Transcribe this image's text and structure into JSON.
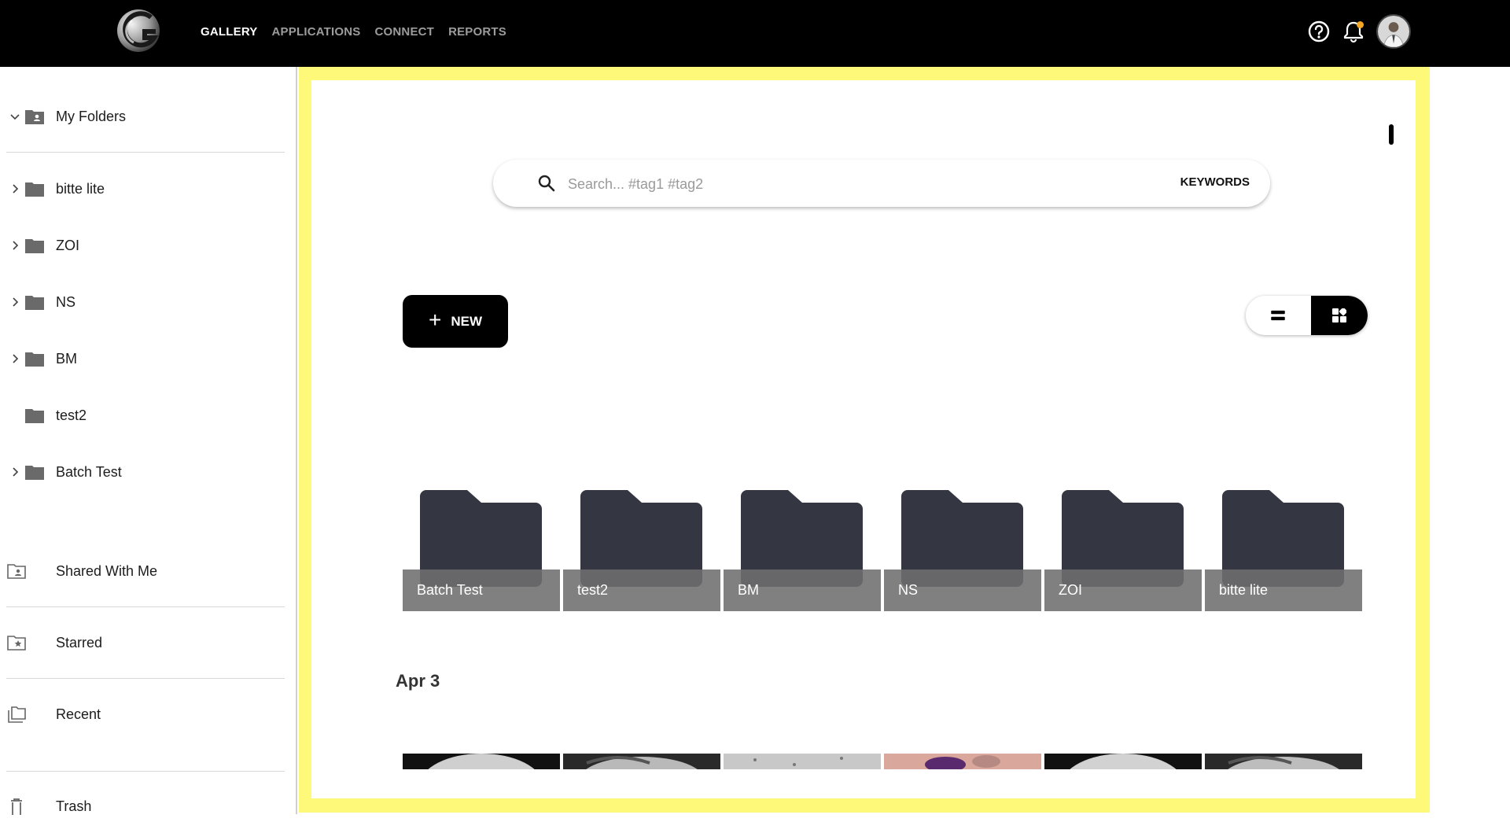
{
  "topbar": {
    "nav": [
      "GALLERY",
      "APPLICATIONS",
      "CONNECT",
      "REPORTS"
    ],
    "active_nav": "GALLERY",
    "notification_color": "#f5a623"
  },
  "sidebar": {
    "my_folders_label": "My Folders",
    "folders": [
      {
        "label": "bitte lite",
        "expandable": true
      },
      {
        "label": "ZOI",
        "expandable": true
      },
      {
        "label": "NS",
        "expandable": true
      },
      {
        "label": "BM",
        "expandable": true
      },
      {
        "label": "test2",
        "expandable": false
      },
      {
        "label": "Batch Test",
        "expandable": true
      }
    ],
    "shared_label": "Shared With Me",
    "starred_label": "Starred",
    "recent_label": "Recent",
    "trash_label": "Trash"
  },
  "main": {
    "search_placeholder": "Search... #tag1 #tag2",
    "keywords_label": "KEYWORDS",
    "new_label": "NEW",
    "folder_cards": [
      "Batch Test",
      "test2",
      "BM",
      "NS",
      "ZOI",
      "bitte lite"
    ],
    "date_heading": "Apr 3",
    "highlight_color": "#fff97a"
  }
}
